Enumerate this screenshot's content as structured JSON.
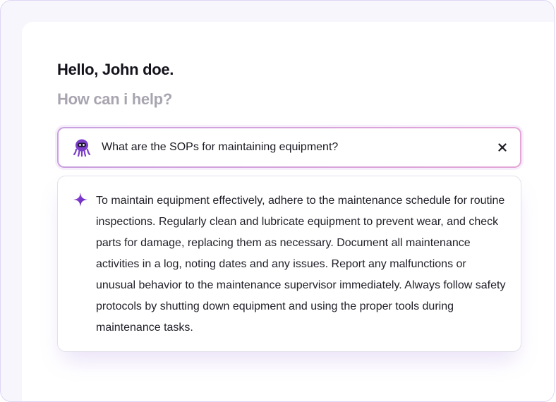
{
  "greeting": "Hello, John doe.",
  "subgreeting": "How can i help?",
  "search": {
    "query": "What are the SOPs for maintaining equipment?",
    "assistant_icon": "octopus-bot-icon",
    "clear_icon": "close-icon"
  },
  "answer": {
    "icon": "sparkle-icon",
    "text": "To maintain equipment effectively, adhere to the maintenance schedule for routine inspections. Regularly clean and lubricate equipment to prevent wear, and check parts for damage, replacing them as necessary. Document all maintenance activities in a log, noting dates and any issues. Report any malfunctions or unusual behavior to the maintenance supervisor immediately. Always follow safety protocols by shutting down equipment and using the proper tools during maintenance tasks."
  },
  "colors": {
    "accent": "#7b3fc9",
    "border_gradient_start": "#c9a0e0",
    "border_gradient_end": "#e3a6d6",
    "text_primary": "#14121b",
    "text_muted": "#a8a5b0"
  }
}
